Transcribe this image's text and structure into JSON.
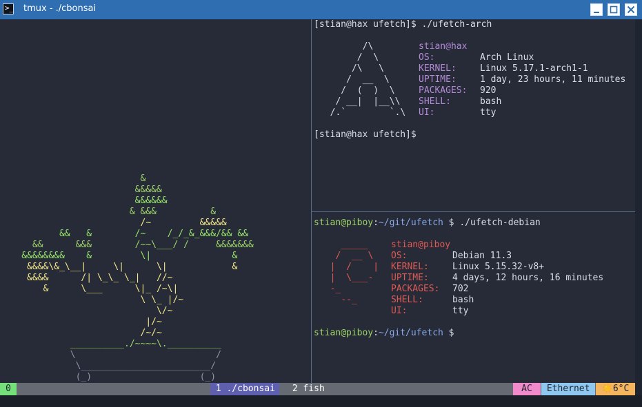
{
  "window": {
    "title": "tmux - ./cbonsai",
    "app_icon": ">_"
  },
  "left_pane": {
    "bonsai_lines": [
      {
        "text": "                          &",
        "color": "green"
      },
      {
        "text": "                         &&&&&",
        "color": "green"
      },
      {
        "text": "                         &&&&&&",
        "color": "lime"
      },
      {
        "text": "                        & &&&          &",
        "color": "green"
      },
      {
        "text": "                          /~         &&&&&",
        "color": "yellow"
      },
      {
        "text": "           &&   &        /~    /_/_&_&&&/&& &&",
        "color": "lime"
      },
      {
        "text": "      &&      &&&        /~~\\___/ /     &&&&&&&",
        "color": "green"
      },
      {
        "text": "    &&&&&&&&    &         \\|               &",
        "color": "lime"
      },
      {
        "text": "     &&&&\\&_\\__|     \\|      \\|            &",
        "color": "yellow"
      },
      {
        "text": "     &&&&      /| \\_\\_ \\_|   //~",
        "color": "yellow"
      },
      {
        "text": "        &      \\___      \\|_ /~\\|",
        "color": "yellow"
      },
      {
        "text": "                          \\ \\_ |/~",
        "color": "yellow"
      },
      {
        "text": "                             \\/~",
        "color": "yellow"
      },
      {
        "text": "                           |/~",
        "color": "yellow"
      },
      {
        "text": "                          /~/~",
        "color": "yellow"
      },
      {
        "text": "             __________./~~~~\\.__________",
        "color": "green"
      },
      {
        "text": "             \\                          /",
        "color": "gray"
      },
      {
        "text": "              \\________________________/",
        "color": "gray"
      },
      {
        "text": "              (_)                    (_)",
        "color": "gray"
      }
    ]
  },
  "top_right_pane": {
    "prompt": "[stian@hax ufetch]$ ./ufetch-arch",
    "logo": [
      "        /\\",
      "       /  \\",
      "      /\\   \\",
      "     /  __  \\",
      "    /  (  )  \\",
      "   / __|  |__\\\\",
      "  /.`        `.\\"
    ],
    "user": "stian@hax",
    "fields": [
      {
        "label": "OS:",
        "value": "Arch Linux"
      },
      {
        "label": "KERNEL:",
        "value": "Linux 5.17.1-arch1-1"
      },
      {
        "label": "UPTIME:",
        "value": "1 day, 23 hours, 11 minutes"
      },
      {
        "label": "PACKAGES:",
        "value": "920"
      },
      {
        "label": "SHELL:",
        "value": "bash"
      },
      {
        "label": "UI:",
        "value": "tty"
      }
    ],
    "prompt_end": "[stian@hax ufetch]$"
  },
  "bottom_right_pane": {
    "prompt_user": "stian@piboy",
    "prompt_sep": ":",
    "prompt_path": "~/git/ufetch",
    "prompt_cmd": " $ ./ufetch-debian",
    "logo": [
      "    _____",
      "   /  __ \\",
      "  |  /    |",
      "  |  \\___-",
      "  -_",
      "    --_"
    ],
    "user": "stian@piboy",
    "fields": [
      {
        "label": "OS:",
        "value": "Debian 11.3"
      },
      {
        "label": "KERNEL:",
        "value": "Linux 5.15.32-v8+"
      },
      {
        "label": "UPTIME:",
        "value": "4 days, 12 hours, 16 minutes"
      },
      {
        "label": "PACKAGES:",
        "value": "702"
      },
      {
        "label": "SHELL:",
        "value": "bash"
      },
      {
        "label": "UI:",
        "value": "tty"
      }
    ],
    "prompt_end": " $"
  },
  "statusbar": {
    "session": "0",
    "windows": [
      {
        "label": " 1 ./cbonsai ",
        "active": true
      },
      {
        "label": " 2 fish",
        "active": false
      }
    ],
    "power": " AC ",
    "network": " Ethernet ",
    "weather": "☀️6°C"
  },
  "colors": {
    "accent_title": "#2f6fb1",
    "active_window": "#5f5fb0",
    "power_bg": "#f18acb",
    "network_bg": "#8ec8f0",
    "weather_bg": "#f5b55f"
  }
}
